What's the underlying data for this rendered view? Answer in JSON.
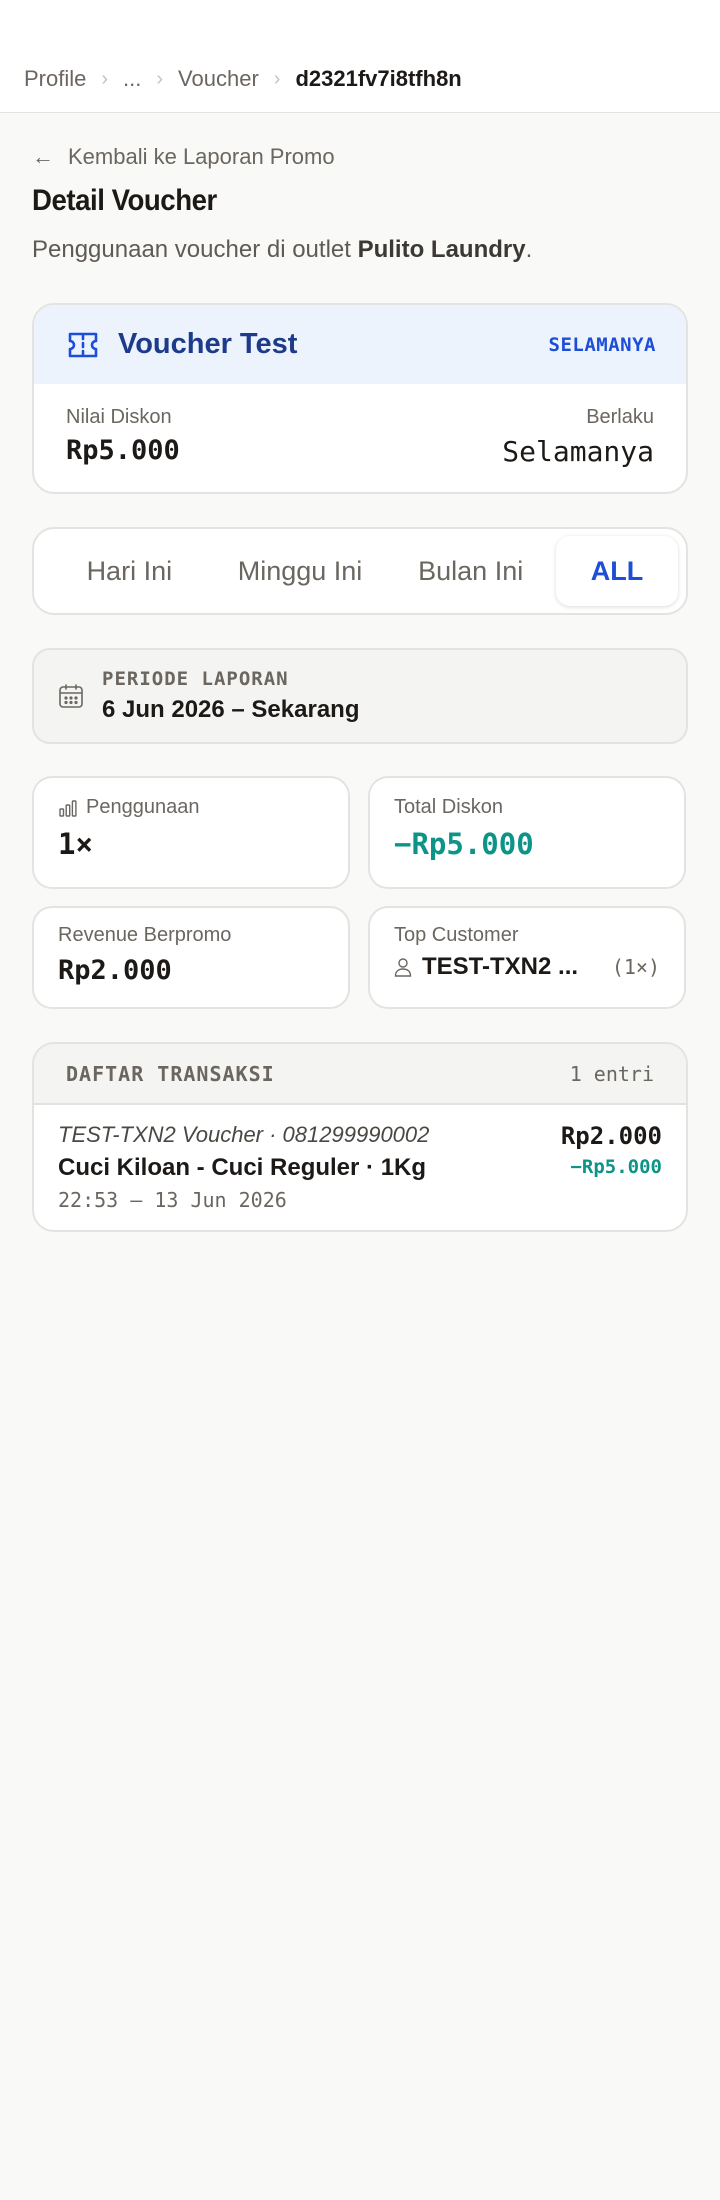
{
  "breadcrumb": {
    "items": [
      "Profile",
      "...",
      "Voucher"
    ],
    "current": "d2321fv7i8tfh8n"
  },
  "back_link": "Kembali ke Laporan Promo",
  "page": {
    "title": "Detail Voucher",
    "subtitle_prefix": "Penggunaan voucher di outlet ",
    "outlet_name": "Pulito Laundry",
    "subtitle_suffix": "."
  },
  "voucher": {
    "icon": "ticket-icon",
    "name": "Voucher Test",
    "badge": "SELAMANYA",
    "discount_label": "Nilai Diskon",
    "discount_value": "Rp5.000",
    "valid_label": "Berlaku",
    "valid_value": "Selamanya"
  },
  "tabs": {
    "items": [
      "Hari Ini",
      "Minggu Ini",
      "Bulan Ini",
      "ALL"
    ],
    "active": "ALL"
  },
  "period": {
    "icon": "calendar-icon",
    "label": "PERIODE LAPORAN",
    "value": "6 Jun 2026 – Sekarang"
  },
  "stats": {
    "usage": {
      "icon": "bar-chart-icon",
      "label": "Penggunaan",
      "value": "1×"
    },
    "total_discount": {
      "label": "Total Diskon",
      "value": "−Rp5.000"
    },
    "revenue": {
      "label": "Revenue Berpromo",
      "value": "Rp2.000"
    },
    "top_customer": {
      "icon": "user-icon",
      "label": "Top Customer",
      "name": "TEST-TXN2 ...",
      "count": "(1×)"
    }
  },
  "transactions": {
    "title": "DAFTAR TRANSAKSI",
    "count": "1 entri",
    "rows": [
      {
        "customer": "TEST-TXN2 Voucher · 081299990002",
        "service": "Cuci Kiloan - Cuci Reguler · 1Kg",
        "time": "22:53 — 13 Jun 2026",
        "amount": "Rp2.000",
        "discount": "−Rp5.000"
      }
    ]
  },
  "colors": {
    "accent_blue": "#1d4ed8",
    "voucher_header_bg": "#ecf3fd",
    "teal": "#0d9488"
  }
}
